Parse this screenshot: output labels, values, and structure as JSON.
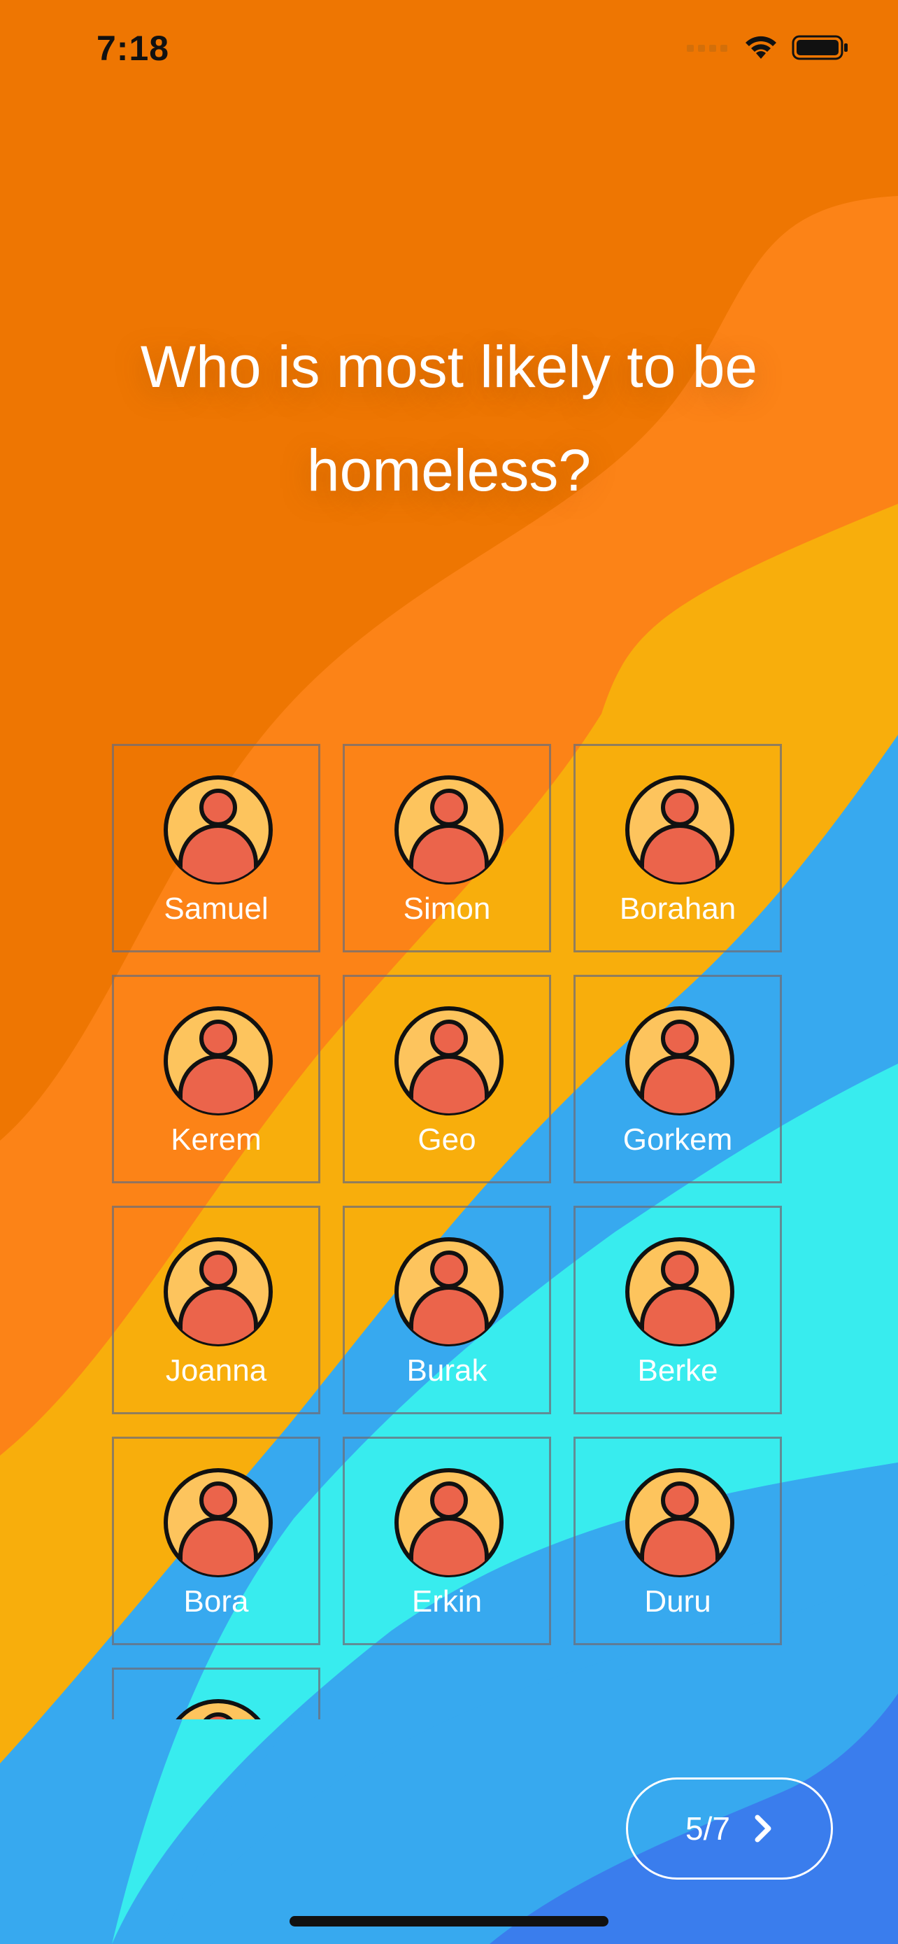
{
  "status_bar": {
    "time": "7:18"
  },
  "question": "Who is most likely to be homeless?",
  "players": [
    {
      "name": "Samuel"
    },
    {
      "name": "Simon"
    },
    {
      "name": "Borahan"
    },
    {
      "name": "Kerem"
    },
    {
      "name": "Geo"
    },
    {
      "name": "Gorkem"
    },
    {
      "name": "Joanna"
    },
    {
      "name": "Burak"
    },
    {
      "name": "Berke"
    },
    {
      "name": "Bora"
    },
    {
      "name": "Erkin"
    },
    {
      "name": "Duru"
    },
    {
      "name": ""
    }
  ],
  "progress": {
    "label": "5/7",
    "current": 5,
    "total": 7
  },
  "icons": {
    "avatar": "user-avatar-icon",
    "next": "chevron-right-icon"
  },
  "colors": {
    "orange_dark": "#EE7602",
    "orange": "#FC8317",
    "amber": "#F8AE0C",
    "sky_blue": "#37A9EF",
    "cyan": "#38ECEE",
    "royal_blue": "#3A7DED",
    "avatar_face": "#FDC45D",
    "avatar_person": "#EB644B"
  }
}
